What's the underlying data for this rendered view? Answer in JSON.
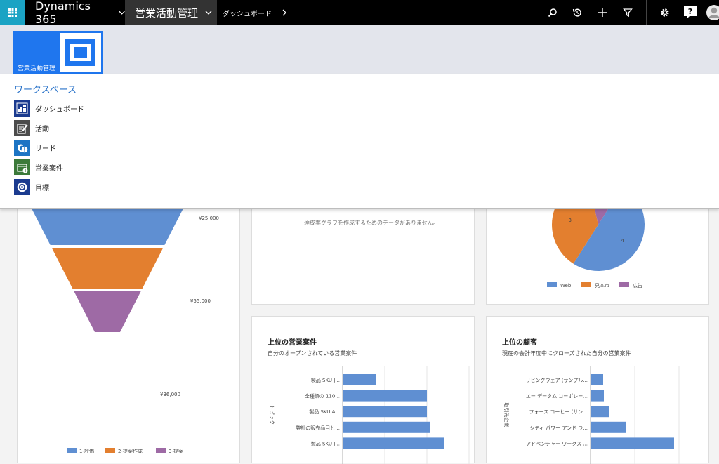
{
  "nav": {
    "app_name": "Dynamics 365",
    "area_name": "営業活動管理",
    "breadcrumb": "ダッシュボード",
    "icons": [
      "waffle-icon",
      "search-icon",
      "recent-icon",
      "plus-icon",
      "filter-icon",
      "gear-icon",
      "help-icon",
      "user-icon"
    ],
    "help_glyph": "?",
    "accent": "#1ba3c4"
  },
  "sitemap": {
    "area_tile_label": "営業活動管理",
    "workspace_title": "ワークスペース",
    "items": [
      {
        "label": "ダッシュボード",
        "icon": "dashboard-icon"
      },
      {
        "label": "活動",
        "icon": "activity-icon"
      },
      {
        "label": "リード",
        "icon": "lead-icon"
      },
      {
        "label": "営業案件",
        "icon": "opportunity-icon"
      },
      {
        "label": "目標",
        "icon": "goal-icon"
      }
    ]
  },
  "dashboard": {
    "goal_empty_message": "達成率グラフを作成するためのデータがありません。",
    "top_opportunities": {
      "title": "上位の営業案件",
      "subtitle": "自分のオープンされている営業案件"
    },
    "top_customers": {
      "title": "上位の顧客",
      "subtitle": "現在の会計年度中にクローズされた自分の営業案件"
    }
  },
  "chart_data": [
    {
      "type": "funnel",
      "categories": [
        "1-評価",
        "2-提案作成",
        "3-提案"
      ],
      "values": [
        25000,
        55000,
        36000
      ],
      "value_labels": [
        "¥25,000",
        "¥55,000",
        "¥36,000"
      ],
      "colors": [
        "#5f8fd2",
        "#e37f2f",
        "#9e6aa5"
      ],
      "legend": "bottom"
    },
    {
      "type": "pie",
      "categories": [
        "Web",
        "見本市",
        "広告"
      ],
      "values": [
        4,
        3,
        1
      ],
      "colors": [
        "#5f8fd2",
        "#e37f2f",
        "#9e6aa5"
      ],
      "legend": "bottom"
    },
    {
      "type": "bar",
      "orientation": "horizontal",
      "ylabel": "トピック",
      "categories": [
        "製品 SKU J...",
        "全種類の 110...",
        "製品 SKU A...",
        "弊社の販売品目と...",
        "製品 SKU J..."
      ],
      "values": [
        47,
        120,
        120,
        125,
        144
      ],
      "color": "#5f8fd2",
      "grid": true
    },
    {
      "type": "bar",
      "orientation": "horizontal",
      "ylabel": "取引先企業",
      "categories": [
        "リビングウェア (サンプル...",
        "エー データム コーポレー...",
        "フォース コーヒー (サン...",
        "シティ パワー アンド ラ...",
        "アドベンチャー ワークス ..."
      ],
      "values": [
        18,
        19,
        27,
        50,
        119
      ],
      "color": "#5f8fd2",
      "grid": true
    }
  ]
}
